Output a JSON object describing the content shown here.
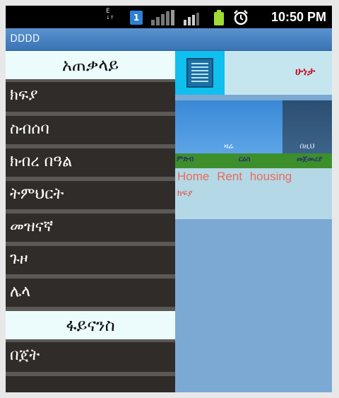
{
  "status_bar": {
    "network_type": "E",
    "sim_slot": "1",
    "time": "10:50 PM"
  },
  "title_bar": {
    "title": "ᎠᎠᎠᎠ"
  },
  "drawer": {
    "header": "አጠቃላይ",
    "items": [
      "ክፍያ",
      "ስብሰባ",
      "ክብረ በዓል",
      "ትምህርት",
      "መዝናኛ",
      "ጉዞ",
      "ሌላ"
    ],
    "section_header": "ፋይናንስ",
    "section_items": [
      "በጀት"
    ]
  },
  "main": {
    "app_title": "ሁነታ",
    "tabs": [
      "ዛሬ",
      "በዚህ"
    ],
    "columns": [
      "ምድብ",
      "ርዕስ",
      "መጀመሪያ"
    ],
    "row": {
      "title": "Home Rent housing",
      "category": "ክፍያ"
    }
  },
  "colors": {
    "drawer_background": "#302c29",
    "drawer_header": "#ecfcfc",
    "title_bar": "#3a74b4",
    "menu_button": "#10bfee",
    "row_text": "#e86b5c",
    "app_title": "#c0182a"
  },
  "icons": {
    "menu": "list-menu-icon",
    "battery": "battery-icon",
    "alarm": "alarm-clock-icon",
    "signal": "signal-bars-icon"
  }
}
